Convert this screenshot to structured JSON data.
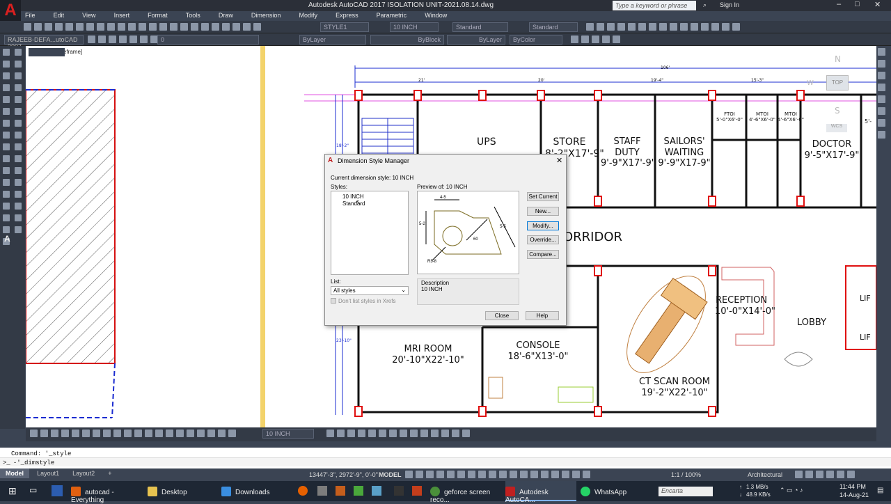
{
  "window": {
    "title": "Autodesk AutoCAD 2017    ISOLATION UNIT-2021.08.14.dwg",
    "search_placeholder": "Type a keyword or phrase",
    "sign_in": "Sign In"
  },
  "menu": [
    "File",
    "Edit",
    "View",
    "Insert",
    "Format",
    "Tools",
    "Draw",
    "Dimension",
    "Modify",
    "Express",
    "Parametric",
    "Window"
  ],
  "toolbar": {
    "text_style": "STYLE1",
    "dim_style": "10 INCH",
    "table_style": "Standard",
    "mleader_style": "Standard",
    "layer_path": "RAJEEB-DEFA...utoCAD 2007",
    "layer_value": "0",
    "color": "ByLayer",
    "linetype": "ByBlock",
    "lineweight": "ByLayer",
    "plotstyle": "ByColor"
  },
  "viewport_label": "eframe]",
  "viewcube": {
    "n": "N",
    "s": "S",
    "w": "W",
    "top": "TOP",
    "wcs": "WCS"
  },
  "rooms": {
    "ups": "UPS",
    "store": "STORE",
    "store_size": "8'-2\"X17'-9\"",
    "staff": "STAFF DUTY",
    "staff_size": "9'-9\"X17'-9\"",
    "sailors": "SAILORS'\nWAITING",
    "sailors_size": "9'-9\"X17-9\"",
    "ftoi": "FTOI",
    "ftoi_size": "5'-0\"X6'-0\"",
    "mtoi1": "MTOI",
    "mtoi1_size": "4'-6\"X6'-0\"",
    "mtoi2": "MTOI",
    "mtoi2_size": "4'-6\"X6'-0\"",
    "doctor": "DOCTOR",
    "doctor_size": "9'-5\"X17'-9\"",
    "corridor": "ORRIDOR",
    "reception": "RECEPTION",
    "reception_size": "10'-0\"X14'-0\"",
    "lobby": "LOBBY",
    "mri": "MRI ROOM",
    "mri_size": "20'-10\"X22'-10\"",
    "console": "CONSOLE",
    "console_size": "18'-6\"X13'-0\"",
    "ct": "CT SCAN ROOM",
    "ct_size": "19'-2\"X22'-10\"",
    "lif1": "LIF",
    "lif2": "LIF",
    "partial_5": "5'-"
  },
  "dims": {
    "top": "106'",
    "d1": "21'",
    "d2": "20'",
    "d3": "19'-4\"",
    "d4": "15'-3\"",
    "side1": "18'-2\"",
    "side2": "23'-10\""
  },
  "dialog": {
    "title": "Dimension Style Manager",
    "current": "Current dimension style: 10 INCH",
    "styles_label": "Styles:",
    "styles": [
      "10 INCH",
      "Standard"
    ],
    "preview_label": "Preview of: 10 INCH",
    "buttons": {
      "set_current": "Set Current",
      "new": "New...",
      "modify": "Modify...",
      "override": "Override...",
      "compare": "Compare...",
      "close": "Close",
      "help": "Help"
    },
    "list_label": "List:",
    "list_value": "All styles",
    "xrefs": "Don't list styles in Xrefs",
    "description_label": "Description",
    "description": "10 INCH",
    "preview_dims": {
      "a": "4-5",
      "b": "5-2",
      "c": "5-5",
      "d": "60",
      "e": "R3-8"
    }
  },
  "bottom_toolbar": {
    "dim_style": "10 INCH"
  },
  "command": {
    "line1": "Command: '_style",
    "line2": "-'_dimstyle"
  },
  "layouts": [
    "Model",
    "Layout1",
    "Layout2"
  ],
  "status": {
    "coords": "13447'-3\", 2972'-9\", 0'-0\"",
    "model": "MODEL",
    "scale": "1:1 / 100%",
    "units": "Architectural"
  },
  "taskbar": {
    "items": [
      "autocad - Everything",
      "Desktop",
      "Downloads",
      "geforce screen reco...",
      "Autodesk AutoCA...",
      "WhatsApp"
    ],
    "search": "Encarta",
    "net_up": "1.3 MB/s",
    "net_down": "48.9 KB/s",
    "time": "11:44 PM",
    "date": "14-Aug-21"
  }
}
